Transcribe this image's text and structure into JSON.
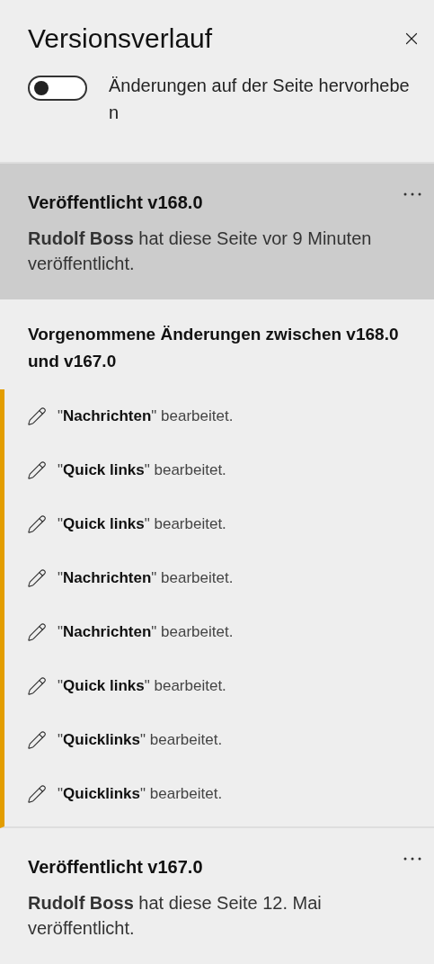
{
  "panel": {
    "title": "Versionsverlauf"
  },
  "highlight_toggle": {
    "label": "Änderungen auf der Seite hervorheben",
    "on": false
  },
  "versions": [
    {
      "title": "Veröffentlicht v168.0",
      "description": "**Rudolf Boss** hat diese Seite vor 9 Minuten veröffentlicht.",
      "selected": true,
      "changes": {
        "heading": "Vorgenommene Änderungen zwischen v168.0 und v167.0",
        "items": [
          "\"**Nachrichten**\" bearbeitet.",
          "\"**Quick links**\" bearbeitet.",
          "\"**Quick links**\" bearbeitet.",
          "\"**Nachrichten**\" bearbeitet.",
          "\"**Nachrichten**\" bearbeitet.",
          "\"**Quick links**\" bearbeitet.",
          "\"**Quicklinks**\" bearbeitet.",
          "\"**Quicklinks**\" bearbeitet."
        ]
      }
    },
    {
      "title": "Veröffentlicht v167.0",
      "description": "**Rudolf Boss** hat diese Seite 12. Mai veröffentlicht.",
      "selected": false
    }
  ]
}
